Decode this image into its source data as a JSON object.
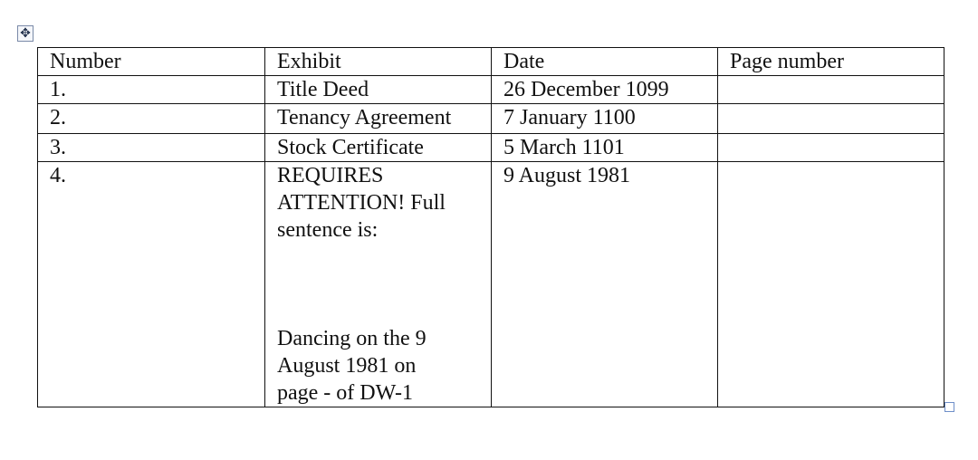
{
  "table": {
    "headers": [
      "Number",
      "Exhibit",
      "Date",
      "Page number"
    ],
    "rows": [
      {
        "number": "1.",
        "exhibit": "Title Deed",
        "date": "26 December 1099",
        "page": ""
      },
      {
        "number": "2.",
        "exhibit": "Tenancy Agreement",
        "date": "7 January 1100",
        "page": ""
      },
      {
        "number": "3.",
        "exhibit": "Stock Certificate",
        "date": "5 March 1101",
        "page": ""
      },
      {
        "number": "4.",
        "exhibit_part1": "REQUIRES\nATTENTION! Full\nsentence is:",
        "exhibit_part2": "Dancing on the 9\nAugust 1981 on\npage - of DW-1",
        "date": "9 August 1981",
        "page": ""
      }
    ]
  },
  "icons": {
    "move_handle": "move-arrows-icon",
    "resize_handle": "resize-square-icon"
  }
}
